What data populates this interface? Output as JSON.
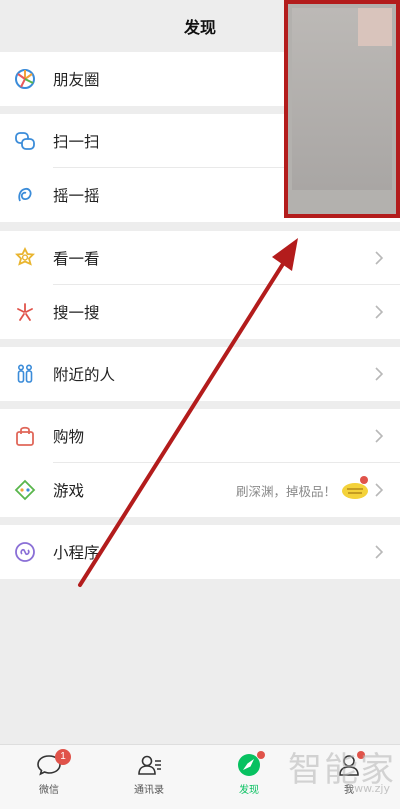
{
  "header": {
    "title": "发现"
  },
  "groups": [
    {
      "items": [
        {
          "label": "朋友圈",
          "icon": "moments-icon"
        }
      ]
    },
    {
      "items": [
        {
          "label": "扫一扫",
          "icon": "scan-icon"
        },
        {
          "label": "摇一摇",
          "icon": "shake-icon"
        }
      ]
    },
    {
      "items": [
        {
          "label": "看一看",
          "icon": "top-stories-icon"
        },
        {
          "label": "搜一搜",
          "icon": "search-icon"
        }
      ]
    },
    {
      "items": [
        {
          "label": "附近的人",
          "icon": "people-nearby-icon"
        }
      ]
    },
    {
      "items": [
        {
          "label": "购物",
          "icon": "shopping-bag-icon"
        },
        {
          "label": "游戏",
          "icon": "games-icon",
          "note": "刷深渊，掉极品！"
        }
      ]
    },
    {
      "items": [
        {
          "label": "小程序",
          "icon": "mini-programs-icon"
        }
      ]
    }
  ],
  "tabbar": {
    "tabs": [
      {
        "label": "微信",
        "icon": "chat-icon",
        "badge": "1"
      },
      {
        "label": "通讯录",
        "icon": "contacts-icon"
      },
      {
        "label": "发现",
        "icon": "discover-icon",
        "active": true,
        "dot": true
      },
      {
        "label": "我",
        "icon": "me-icon",
        "dot": true
      }
    ]
  },
  "watermark": {
    "text": "智能家",
    "url": "www.zjy"
  },
  "colors": {
    "accent": "#07c160",
    "badge": "#e0534a",
    "annotation": "#b31c1c"
  }
}
